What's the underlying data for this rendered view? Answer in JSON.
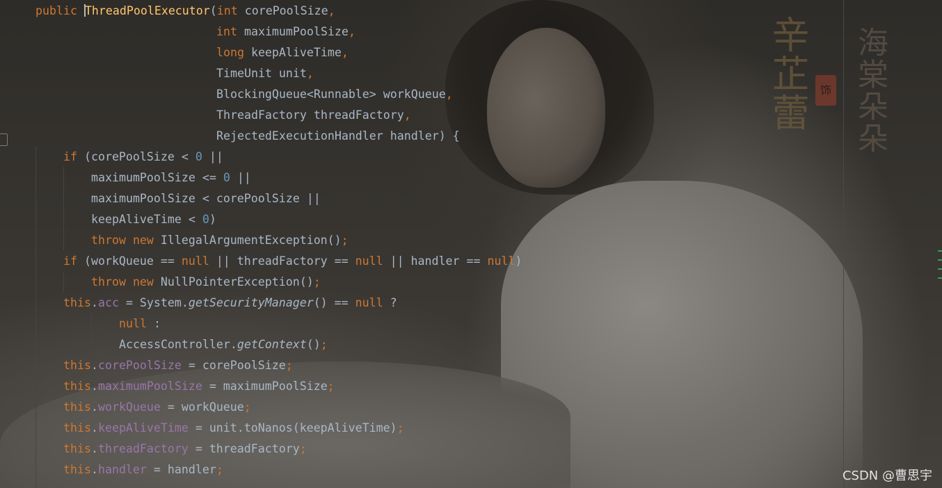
{
  "editor": {
    "lines": [
      {
        "indent": 0,
        "tokens": [
          {
            "t": "public ",
            "c": "kw"
          },
          {
            "t": "",
            "c": "caret"
          },
          {
            "t": "ThreadPoolExecutor",
            "c": "fn"
          },
          {
            "t": "(",
            "c": "pl"
          },
          {
            "t": "int ",
            "c": "kw"
          },
          {
            "t": "corePoolSize",
            "c": "pl"
          },
          {
            "t": ",",
            "c": "kw"
          }
        ]
      },
      {
        "indent": 1,
        "tokens": [
          {
            "t": "int ",
            "c": "kw"
          },
          {
            "t": "maximumPoolSize",
            "c": "pl"
          },
          {
            "t": ",",
            "c": "kw"
          }
        ]
      },
      {
        "indent": 1,
        "tokens": [
          {
            "t": "long ",
            "c": "kw"
          },
          {
            "t": "keepAliveTime",
            "c": "pl"
          },
          {
            "t": ",",
            "c": "kw"
          }
        ]
      },
      {
        "indent": 1,
        "tokens": [
          {
            "t": "TimeUnit unit",
            "c": "pl"
          },
          {
            "t": ",",
            "c": "kw"
          }
        ]
      },
      {
        "indent": 1,
        "tokens": [
          {
            "t": "BlockingQueue<Runnable> workQueue",
            "c": "pl"
          },
          {
            "t": ",",
            "c": "kw"
          }
        ]
      },
      {
        "indent": 1,
        "tokens": [
          {
            "t": "ThreadFactory threadFactory",
            "c": "pl"
          },
          {
            "t": ",",
            "c": "kw"
          }
        ]
      },
      {
        "indent": 1,
        "tokens": [
          {
            "t": "RejectedExecutionHandler handler) {",
            "c": "pl"
          }
        ]
      },
      {
        "indent": 2,
        "tokens": [
          {
            "t": "if ",
            "c": "kw"
          },
          {
            "t": "(corePoolSize < ",
            "c": "pl"
          },
          {
            "t": "0",
            "c": "num"
          },
          {
            "t": " ||",
            "c": "pl"
          }
        ]
      },
      {
        "indent": 3,
        "tokens": [
          {
            "t": "maximumPoolSize <= ",
            "c": "pl"
          },
          {
            "t": "0",
            "c": "num"
          },
          {
            "t": " ||",
            "c": "pl"
          }
        ]
      },
      {
        "indent": 3,
        "tokens": [
          {
            "t": "maximumPoolSize < corePoolSize ||",
            "c": "pl"
          }
        ]
      },
      {
        "indent": 3,
        "tokens": [
          {
            "t": "keepAliveTime < ",
            "c": "pl"
          },
          {
            "t": "0",
            "c": "num"
          },
          {
            "t": ")",
            "c": "pl"
          }
        ]
      },
      {
        "indent": 3,
        "tokens": [
          {
            "t": "throw new ",
            "c": "kw"
          },
          {
            "t": "IllegalArgumentException()",
            "c": "pl"
          },
          {
            "t": ";",
            "c": "kw"
          }
        ]
      },
      {
        "indent": 2,
        "tokens": [
          {
            "t": "if ",
            "c": "kw"
          },
          {
            "t": "(workQueue == ",
            "c": "pl"
          },
          {
            "t": "null",
            "c": "kw"
          },
          {
            "t": " || threadFactory == ",
            "c": "pl"
          },
          {
            "t": "null",
            "c": "kw"
          },
          {
            "t": " || handler == ",
            "c": "pl"
          },
          {
            "t": "null",
            "c": "kw"
          },
          {
            "t": ")",
            "c": "pl"
          }
        ]
      },
      {
        "indent": 3,
        "tokens": [
          {
            "t": "throw new ",
            "c": "kw"
          },
          {
            "t": "NullPointerException()",
            "c": "pl"
          },
          {
            "t": ";",
            "c": "kw"
          }
        ]
      },
      {
        "indent": 2,
        "tokens": [
          {
            "t": "this",
            "c": "kw"
          },
          {
            "t": ".",
            "c": "pl"
          },
          {
            "t": "acc",
            "c": "fd"
          },
          {
            "t": " = System.",
            "c": "pl"
          },
          {
            "t": "getSecurityManager",
            "c": "it"
          },
          {
            "t": "() == ",
            "c": "pl"
          },
          {
            "t": "null",
            "c": "kw"
          },
          {
            "t": " ?",
            "c": "pl"
          }
        ]
      },
      {
        "indent": 4,
        "tokens": [
          {
            "t": "null",
            "c": "kw"
          },
          {
            "t": " :",
            "c": "pl"
          }
        ]
      },
      {
        "indent": 4,
        "tokens": [
          {
            "t": "AccessController.",
            "c": "pl"
          },
          {
            "t": "getContext",
            "c": "it"
          },
          {
            "t": "()",
            "c": "pl"
          },
          {
            "t": ";",
            "c": "kw"
          }
        ]
      },
      {
        "indent": 2,
        "tokens": [
          {
            "t": "this",
            "c": "kw"
          },
          {
            "t": ".",
            "c": "pl"
          },
          {
            "t": "corePoolSize",
            "c": "fd"
          },
          {
            "t": " = corePoolSize",
            "c": "pl"
          },
          {
            "t": ";",
            "c": "kw"
          }
        ]
      },
      {
        "indent": 2,
        "tokens": [
          {
            "t": "this",
            "c": "kw"
          },
          {
            "t": ".",
            "c": "pl"
          },
          {
            "t": "maximumPoolSize",
            "c": "fd"
          },
          {
            "t": " = maximumPoolSize",
            "c": "pl"
          },
          {
            "t": ";",
            "c": "kw"
          }
        ]
      },
      {
        "indent": 2,
        "tokens": [
          {
            "t": "this",
            "c": "kw"
          },
          {
            "t": ".",
            "c": "pl"
          },
          {
            "t": "workQueue",
            "c": "fd"
          },
          {
            "t": " = workQueue",
            "c": "pl"
          },
          {
            "t": ";",
            "c": "kw"
          }
        ]
      },
      {
        "indent": 2,
        "tokens": [
          {
            "t": "this",
            "c": "kw"
          },
          {
            "t": ".",
            "c": "pl"
          },
          {
            "t": "keepAliveTime",
            "c": "fd"
          },
          {
            "t": " = unit.toNanos(keepAliveTime)",
            "c": "pl"
          },
          {
            "t": ";",
            "c": "kw"
          }
        ]
      },
      {
        "indent": 2,
        "tokens": [
          {
            "t": "this",
            "c": "kw"
          },
          {
            "t": ".",
            "c": "pl"
          },
          {
            "t": "threadFactory",
            "c": "fd"
          },
          {
            "t": " = threadFactory",
            "c": "pl"
          },
          {
            "t": ";",
            "c": "kw"
          }
        ]
      },
      {
        "indent": 2,
        "tokens": [
          {
            "t": "this",
            "c": "kw"
          },
          {
            "t": ".",
            "c": "pl"
          },
          {
            "t": "handler",
            "c": "fd"
          },
          {
            "t": " = handler",
            "c": "pl"
          },
          {
            "t": ";",
            "c": "kw"
          }
        ]
      }
    ]
  },
  "background": {
    "calligraphy_left": "辛芷蕾",
    "calligraphy_right": "海棠朵朵",
    "seal_text": "饰"
  },
  "colors": {
    "keyword": "#cc7832",
    "method_declaration": "#ffc66d",
    "field": "#9876aa",
    "number": "#6897bb",
    "plain": "#a9b7c6"
  },
  "watermark": "CSDN @曹思宇"
}
